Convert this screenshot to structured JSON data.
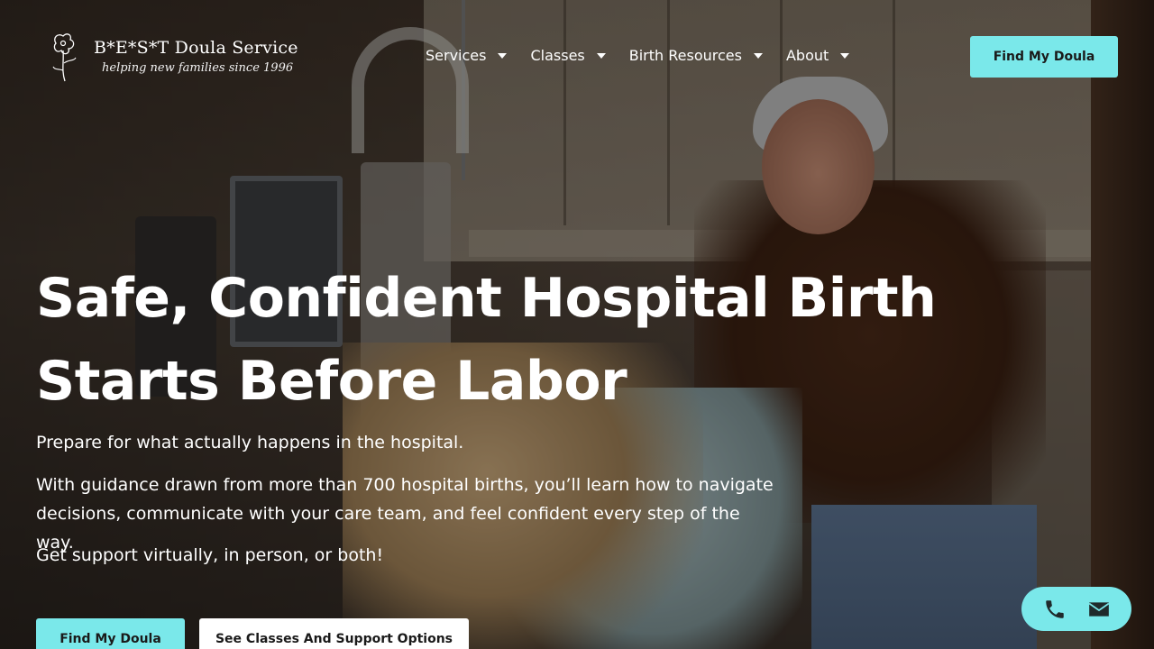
{
  "brand": {
    "name": "B*E*S*T Doula Service",
    "tagline": "helping new families since 1996"
  },
  "nav": {
    "items": [
      {
        "label": "Services"
      },
      {
        "label": "Classes"
      },
      {
        "label": "Birth Resources"
      },
      {
        "label": "About"
      }
    ],
    "cta_label": "Find My Doula"
  },
  "hero": {
    "title_line1": "Safe, Confident Hospital Birth",
    "title_line2": "Starts Before Labor",
    "p1": "Prepare for what actually happens in the hospital.",
    "p2": "With guidance drawn from more than 700 hospital births, you’ll learn how to navigate decisions, communicate with your care team, and feel confident every step of the way.",
    "p3": "Get support virtually, in person, or both!",
    "btn_primary": "Find My Doula",
    "btn_secondary": "See Classes And Support Options"
  },
  "contact_widget": {
    "icons": [
      "phone-icon",
      "envelope-icon"
    ]
  },
  "colors": {
    "accent": "#7ae8ea",
    "text": "#ffffff",
    "button_text": "#1a1a1a"
  }
}
